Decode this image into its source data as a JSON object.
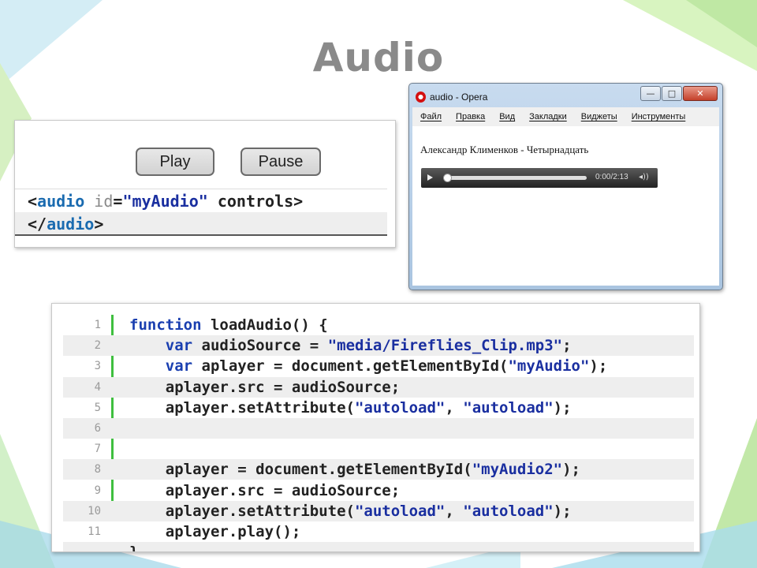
{
  "slide": {
    "title": "Audio"
  },
  "demo_panel": {
    "play_label": "Play",
    "pause_label": "Pause",
    "tag_line1": {
      "open": "<",
      "tag": "audio",
      "attr": " id",
      "eq": "=",
      "val": "\"myAudio\"",
      "rest": " controls>"
    },
    "tag_line2": {
      "open": "</",
      "tag": "audio",
      "close": ">"
    }
  },
  "browser": {
    "title": "audio - Opera",
    "menu": [
      "Файл",
      "Правка",
      "Вид",
      "Закладки",
      "Виджеты",
      "Инструменты"
    ],
    "track_text": "Александр Клименков - Четырнадцать",
    "player_time": "0:00/2:13",
    "player_volume_icon": "◂))"
  },
  "code": {
    "lines": [
      {
        "n": "1",
        "parts": [
          [
            "kw",
            "function"
          ],
          [
            "t",
            " loadAudio() {"
          ]
        ]
      },
      {
        "n": "2",
        "parts": [
          [
            "t",
            "    "
          ],
          [
            "kw",
            "var"
          ],
          [
            "t",
            " audioSource = "
          ],
          [
            "str",
            "\"media/Fireflies_Clip.mp3\""
          ],
          [
            "t",
            ";"
          ]
        ]
      },
      {
        "n": "3",
        "parts": [
          [
            "t",
            "    "
          ],
          [
            "kw",
            "var"
          ],
          [
            "t",
            " aplayer = document.getElementById("
          ],
          [
            "str",
            "\"myAudio\""
          ],
          [
            "t",
            ");"
          ]
        ]
      },
      {
        "n": "4",
        "parts": [
          [
            "t",
            "    aplayer.src = audioSource;"
          ]
        ]
      },
      {
        "n": "5",
        "parts": [
          [
            "t",
            "    aplayer.setAttribute("
          ],
          [
            "str",
            "\"autoload\""
          ],
          [
            "t",
            ", "
          ],
          [
            "str",
            "\"autoload\""
          ],
          [
            "t",
            ");"
          ]
        ]
      },
      {
        "n": "6",
        "parts": []
      },
      {
        "n": "7",
        "parts": []
      },
      {
        "n": "8",
        "parts": [
          [
            "t",
            "    aplayer = document.getElementById("
          ],
          [
            "str",
            "\"myAudio2\""
          ],
          [
            "t",
            ");"
          ]
        ]
      },
      {
        "n": "9",
        "parts": [
          [
            "t",
            "    aplayer.src = audioSource;"
          ]
        ]
      },
      {
        "n": "10",
        "parts": [
          [
            "t",
            "    aplayer.setAttribute("
          ],
          [
            "str",
            "\"autoload\""
          ],
          [
            "t",
            ", "
          ],
          [
            "str",
            "\"autoload\""
          ],
          [
            "t",
            ");"
          ]
        ]
      },
      {
        "n": "11",
        "parts": [
          [
            "t",
            "    aplayer.play();"
          ]
        ]
      },
      {
        "n": "",
        "parts": [
          [
            "t",
            "}"
          ]
        ]
      }
    ]
  }
}
